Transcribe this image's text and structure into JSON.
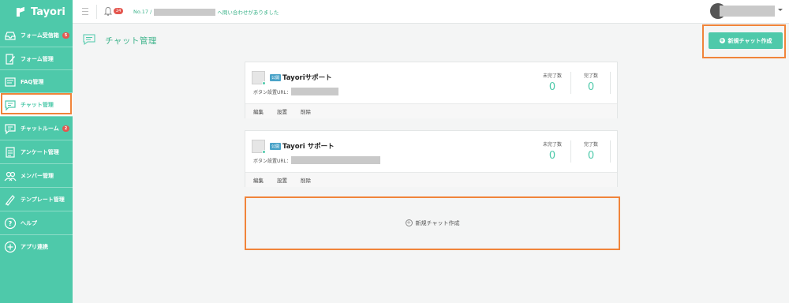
{
  "app": {
    "name": "Tayori"
  },
  "sidebar": {
    "items": [
      {
        "label": "フォーム受信箱",
        "icon": "inbox-icon",
        "badge": "5"
      },
      {
        "label": "フォーム管理",
        "icon": "form-edit-icon"
      },
      {
        "label": "FAQ管理",
        "icon": "faq-icon"
      },
      {
        "label": "チャット管理",
        "icon": "chat-icon",
        "active": true
      },
      {
        "label": "チャットルーム",
        "icon": "chat-room-icon",
        "badge": "2"
      },
      {
        "label": "アンケート管理",
        "icon": "survey-icon"
      },
      {
        "label": "メンバー管理",
        "icon": "members-icon"
      },
      {
        "label": "テンプレート管理",
        "icon": "template-icon"
      },
      {
        "label": "ヘルプ",
        "icon": "help-icon"
      },
      {
        "label": "アプリ連携",
        "icon": "app-link-icon"
      }
    ]
  },
  "header": {
    "notification_count": "24",
    "notice_prefix": "No.17 /",
    "notice_suffix": "へ問い合わせがありました"
  },
  "page": {
    "title": "チャット管理",
    "create_button": "新規チャット作成"
  },
  "chats": [
    {
      "status_tag": "公開",
      "name": "Tayoriサポート",
      "url_label": "ボタン設置URL：",
      "incomplete_label": "未完了数",
      "incomplete_count": "0",
      "complete_label": "完了数",
      "complete_count": "0",
      "actions": [
        "編集",
        "設置",
        "削除"
      ]
    },
    {
      "status_tag": "公開",
      "name": "Tayori サポート",
      "url_label": "ボタン設置URL：",
      "incomplete_label": "未完了数",
      "incomplete_count": "0",
      "complete_label": "完了数",
      "complete_count": "0",
      "actions": [
        "編集",
        "設置",
        "削除"
      ]
    }
  ],
  "new_chat_label": "新規チャット作成",
  "colors": {
    "brand": "#4ec9aa",
    "highlight": "#f0843a",
    "badge": "#e4574f"
  }
}
